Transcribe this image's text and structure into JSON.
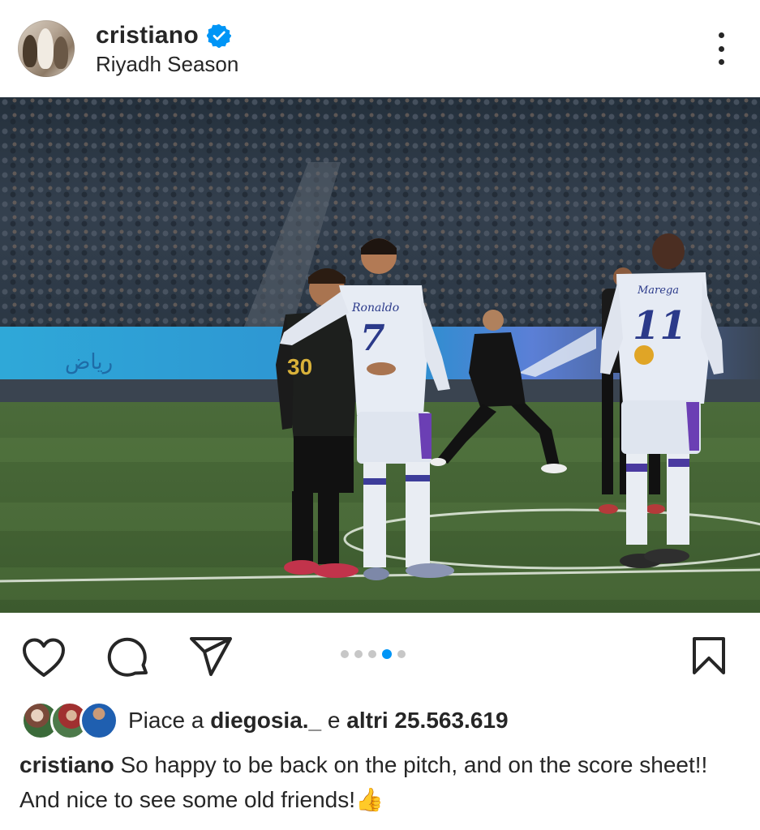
{
  "post": {
    "username": "cristiano",
    "location": "Riyadh Season",
    "verified": true
  },
  "carousel": {
    "count": 5,
    "active_index": 3
  },
  "photo": {
    "jersey_label_left": "Ronaldo",
    "jersey_number_left": "7",
    "jersey_number_black": "30",
    "jersey_label_right": "Marega",
    "jersey_number_right": "11"
  },
  "likes": {
    "prefix": "Piace a",
    "user": "diegosia._",
    "middle": "e",
    "others_label": "altri 25.563.619"
  },
  "caption": {
    "username": "cristiano",
    "text": "So happy to be back on the pitch, and on the score sheet!! And nice to see some old friends!",
    "emoji": "👍"
  },
  "icons": [
    "heart-icon",
    "comment-icon",
    "share-icon",
    "bookmark-icon",
    "more-options-icon",
    "verified-badge-icon"
  ],
  "colors": {
    "text": "#262626",
    "verified": "#0095f6",
    "dot_active": "#0095f6",
    "dot_inactive": "#c7c7c7"
  }
}
